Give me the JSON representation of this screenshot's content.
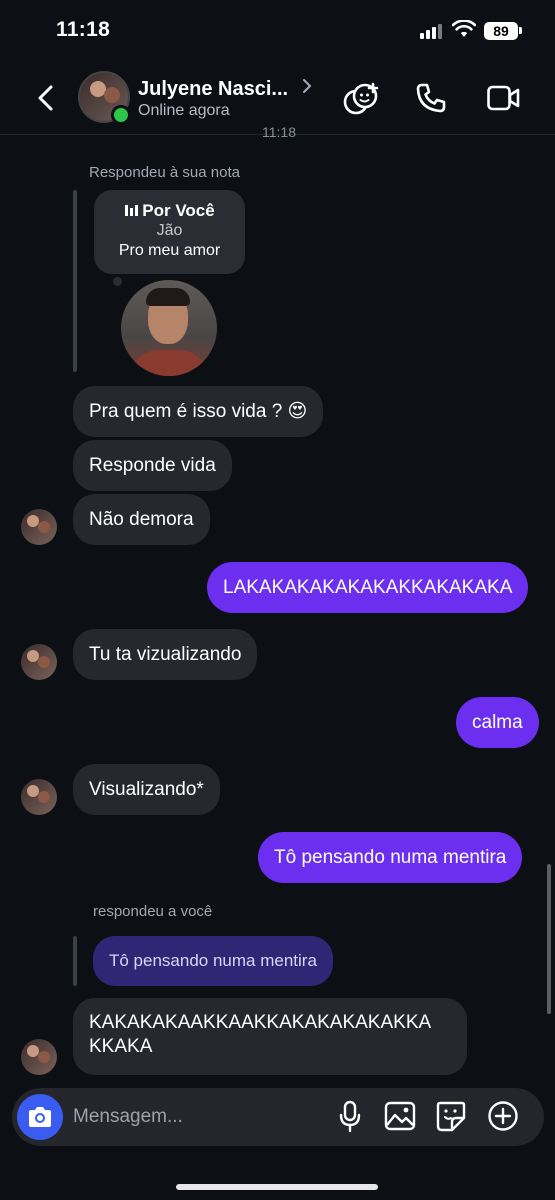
{
  "status_bar": {
    "time": "11:18",
    "battery": "89"
  },
  "header": {
    "contact_name": "Julyene Nasci...",
    "presence": "Online agora"
  },
  "timestamp_peek": "11:18",
  "note_reply": {
    "label": "Respondeu à sua nota",
    "note_title": "Por Você",
    "note_artist": "Jão",
    "note_text": "Pro meu amor"
  },
  "messages": [
    {
      "from": "them",
      "text": "Pra quem é isso vida ? 😍"
    },
    {
      "from": "them",
      "text": "Responde vida"
    },
    {
      "from": "them",
      "text": "Não demora"
    },
    {
      "from": "me",
      "text": "LAKAKAKAKAKAKAKKAKAKAKA"
    },
    {
      "from": "them",
      "text": "Tu ta vizualizando"
    },
    {
      "from": "me",
      "text": "calma"
    },
    {
      "from": "them",
      "text": "Visualizando*"
    },
    {
      "from": "me",
      "text": "Tô pensando numa mentira"
    }
  ],
  "reply_to_you": {
    "label": "respondeu a você",
    "quoted": "Tô pensando numa mentira",
    "text_line1": "KAKAKAKAAKKAAKKAKAKAKAKAKKA",
    "text_line2": "KKAKA"
  },
  "composer": {
    "placeholder": "Mensagem..."
  },
  "colors": {
    "background": "#0c0f14",
    "incoming_bubble": "#26282e",
    "outgoing_bubble": "#6c2ff0",
    "quoted_bubble": "#2f2775",
    "camera_button": "#3a5cf0",
    "online": "#2bc64a"
  },
  "icons": {
    "back": "chevron-left-icon",
    "effects": "sticker-add-icon",
    "call": "phone-icon",
    "video": "video-camera-icon",
    "camera": "camera-icon",
    "mic": "microphone-icon",
    "gallery": "image-icon",
    "sticker": "sticker-icon",
    "more": "plus-circle-icon"
  }
}
